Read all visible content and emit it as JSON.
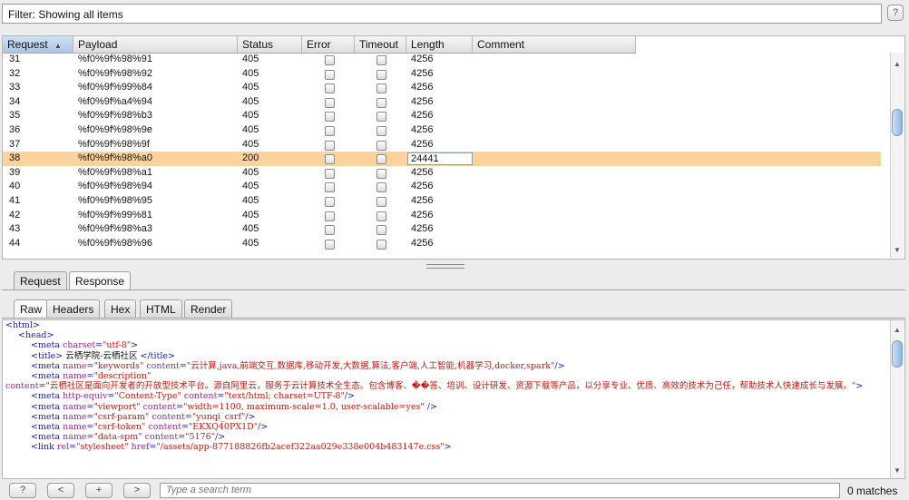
{
  "filter": {
    "label": "Filter: Showing all items"
  },
  "help_label": "?",
  "table": {
    "columns": [
      {
        "label": "Request",
        "sort_arrow": "▲"
      },
      {
        "label": "Payload"
      },
      {
        "label": "Status"
      },
      {
        "label": "Error"
      },
      {
        "label": "Timeout"
      },
      {
        "label": "Length"
      },
      {
        "label": "Comment"
      }
    ],
    "rows": [
      {
        "request": "31",
        "payload": "%f0%9f%98%91",
        "status": "405",
        "length": "4256"
      },
      {
        "request": "32",
        "payload": "%f0%9f%98%92",
        "status": "405",
        "length": "4256"
      },
      {
        "request": "33",
        "payload": "%f0%9f%99%84",
        "status": "405",
        "length": "4256"
      },
      {
        "request": "34",
        "payload": "%f0%9f%a4%94",
        "status": "405",
        "length": "4256"
      },
      {
        "request": "35",
        "payload": "%f0%9f%98%b3",
        "status": "405",
        "length": "4256"
      },
      {
        "request": "36",
        "payload": "%f0%9f%98%9e",
        "status": "405",
        "length": "4256"
      },
      {
        "request": "37",
        "payload": "%f0%9f%98%9f",
        "status": "405",
        "length": "4256"
      },
      {
        "request": "38",
        "payload": "%f0%9f%98%a0",
        "status": "200",
        "length": "24441",
        "selected": true
      },
      {
        "request": "39",
        "payload": "%f0%9f%98%a1",
        "status": "405",
        "length": "4256"
      },
      {
        "request": "40",
        "payload": "%f0%9f%98%94",
        "status": "405",
        "length": "4256"
      },
      {
        "request": "41",
        "payload": "%f0%9f%98%95",
        "status": "405",
        "length": "4256"
      },
      {
        "request": "42",
        "payload": "%f0%9f%99%81",
        "status": "405",
        "length": "4256"
      },
      {
        "request": "43",
        "payload": "%f0%9f%98%a3",
        "status": "405",
        "length": "4256"
      },
      {
        "request": "44",
        "payload": "%f0%9f%98%96",
        "status": "405",
        "length": "4256"
      }
    ]
  },
  "tabs_outer": [
    "Request",
    "Response"
  ],
  "tabs_inner": [
    "Raw",
    "Headers",
    "Hex",
    "HTML",
    "Render"
  ],
  "code_lines": [
    {
      "indent": 0,
      "parts": [
        [
          "tg",
          "<html>"
        ]
      ]
    },
    {
      "indent": 1,
      "parts": [
        [
          "tg",
          "<head>"
        ]
      ]
    },
    {
      "indent": 2,
      "parts": [
        [
          "tg",
          "<meta "
        ],
        [
          "at",
          "charset"
        ],
        [
          "tg",
          "="
        ],
        [
          "st",
          "\"utf-8\""
        ],
        [
          "tg",
          ">"
        ]
      ]
    },
    {
      "indent": 2,
      "parts": [
        [
          "tg",
          "<title>"
        ],
        [
          "tx",
          " 云栖学院-云栖社区 "
        ],
        [
          "tg",
          "</title>"
        ]
      ]
    },
    {
      "indent": 2,
      "parts": [
        [
          "tg",
          "<meta "
        ],
        [
          "at",
          "name"
        ],
        [
          "tg",
          "="
        ],
        [
          "st",
          "\"keywords\""
        ],
        [
          "tg",
          " "
        ],
        [
          "at",
          "content"
        ],
        [
          "tg",
          "="
        ],
        [
          "st",
          "\"云计算,java,前端交互,数据库,移动开发,大数据,算法,客户端,人工智能,机器学习,docker,spark\""
        ],
        [
          "tg",
          "/>"
        ]
      ]
    },
    {
      "indent": 2,
      "parts": [
        [
          "tg",
          "<meta "
        ],
        [
          "at",
          "name"
        ],
        [
          "tg",
          "="
        ],
        [
          "st",
          "\"description\""
        ]
      ]
    },
    {
      "indent": 0,
      "wrap": true,
      "parts": [
        [
          "at",
          "content"
        ],
        [
          "tg",
          "="
        ],
        [
          "st",
          "\"云栖社区是面向开发者的开放型技术平台。源自阿里云，服务于云计算技术全生态。包含博客、��答、培训、设计研发、资源下载等产品，以分享专业、优质、高效的技术为己任，帮助技术人快速成长与发展。\""
        ],
        [
          "tg",
          ">"
        ]
      ]
    },
    {
      "indent": 2,
      "parts": [
        [
          "tg",
          "<meta "
        ],
        [
          "at",
          "http-equiv"
        ],
        [
          "tg",
          "="
        ],
        [
          "st",
          "\"Content-Type\""
        ],
        [
          "tg",
          " "
        ],
        [
          "at",
          "content"
        ],
        [
          "tg",
          "="
        ],
        [
          "st",
          "\"text/html; charset=UTF-8\""
        ],
        [
          "tg",
          "/>"
        ]
      ]
    },
    {
      "indent": 2,
      "parts": [
        [
          "tg",
          "<meta "
        ],
        [
          "at",
          "name"
        ],
        [
          "tg",
          "="
        ],
        [
          "st",
          "\"viewport\""
        ],
        [
          "tg",
          " "
        ],
        [
          "at",
          "content"
        ],
        [
          "tg",
          "="
        ],
        [
          "st",
          "\"width=1100, maximum-scale=1.0, user-scalable=yes\""
        ],
        [
          "tg",
          " />"
        ]
      ]
    },
    {
      "indent": 2,
      "parts": [
        [
          "tg",
          "<meta "
        ],
        [
          "at",
          "name"
        ],
        [
          "tg",
          "="
        ],
        [
          "st",
          "\"csrf-param\""
        ],
        [
          "tg",
          " "
        ],
        [
          "at",
          "content"
        ],
        [
          "tg",
          "="
        ],
        [
          "st",
          "\"yunqi_csrf\""
        ],
        [
          "tg",
          "/>"
        ]
      ]
    },
    {
      "indent": 2,
      "parts": [
        [
          "tg",
          "<meta "
        ],
        [
          "at",
          "name"
        ],
        [
          "tg",
          "="
        ],
        [
          "st",
          "\"csrf-token\""
        ],
        [
          "tg",
          " "
        ],
        [
          "at",
          "content"
        ],
        [
          "tg",
          "="
        ],
        [
          "st",
          "\"EKXQ40PX1D\""
        ],
        [
          "tg",
          "/>"
        ]
      ]
    },
    {
      "indent": 2,
      "parts": [
        [
          "tg",
          "<meta "
        ],
        [
          "at",
          "name"
        ],
        [
          "tg",
          "="
        ],
        [
          "st",
          "\"data-spm\""
        ],
        [
          "tg",
          " "
        ],
        [
          "at",
          "content"
        ],
        [
          "tg",
          "="
        ],
        [
          "st",
          "\"5176\""
        ],
        [
          "tg",
          "/>"
        ]
      ]
    },
    {
      "indent": 2,
      "parts": [
        [
          "tg",
          "<link "
        ],
        [
          "at",
          "rel"
        ],
        [
          "tg",
          "="
        ],
        [
          "st",
          "\"stylesheet\""
        ],
        [
          "tg",
          " "
        ],
        [
          "at",
          "href"
        ],
        [
          "tg",
          "="
        ],
        [
          "st",
          "\"/assets/app-877188826fb2acef322aa029e338e004b483147e.css\""
        ],
        [
          "tg",
          ">"
        ]
      ]
    }
  ],
  "bottom": {
    "buttons": [
      "?",
      "<",
      "+",
      ">"
    ],
    "search_placeholder": "Type a search term",
    "matches": "0 matches"
  }
}
